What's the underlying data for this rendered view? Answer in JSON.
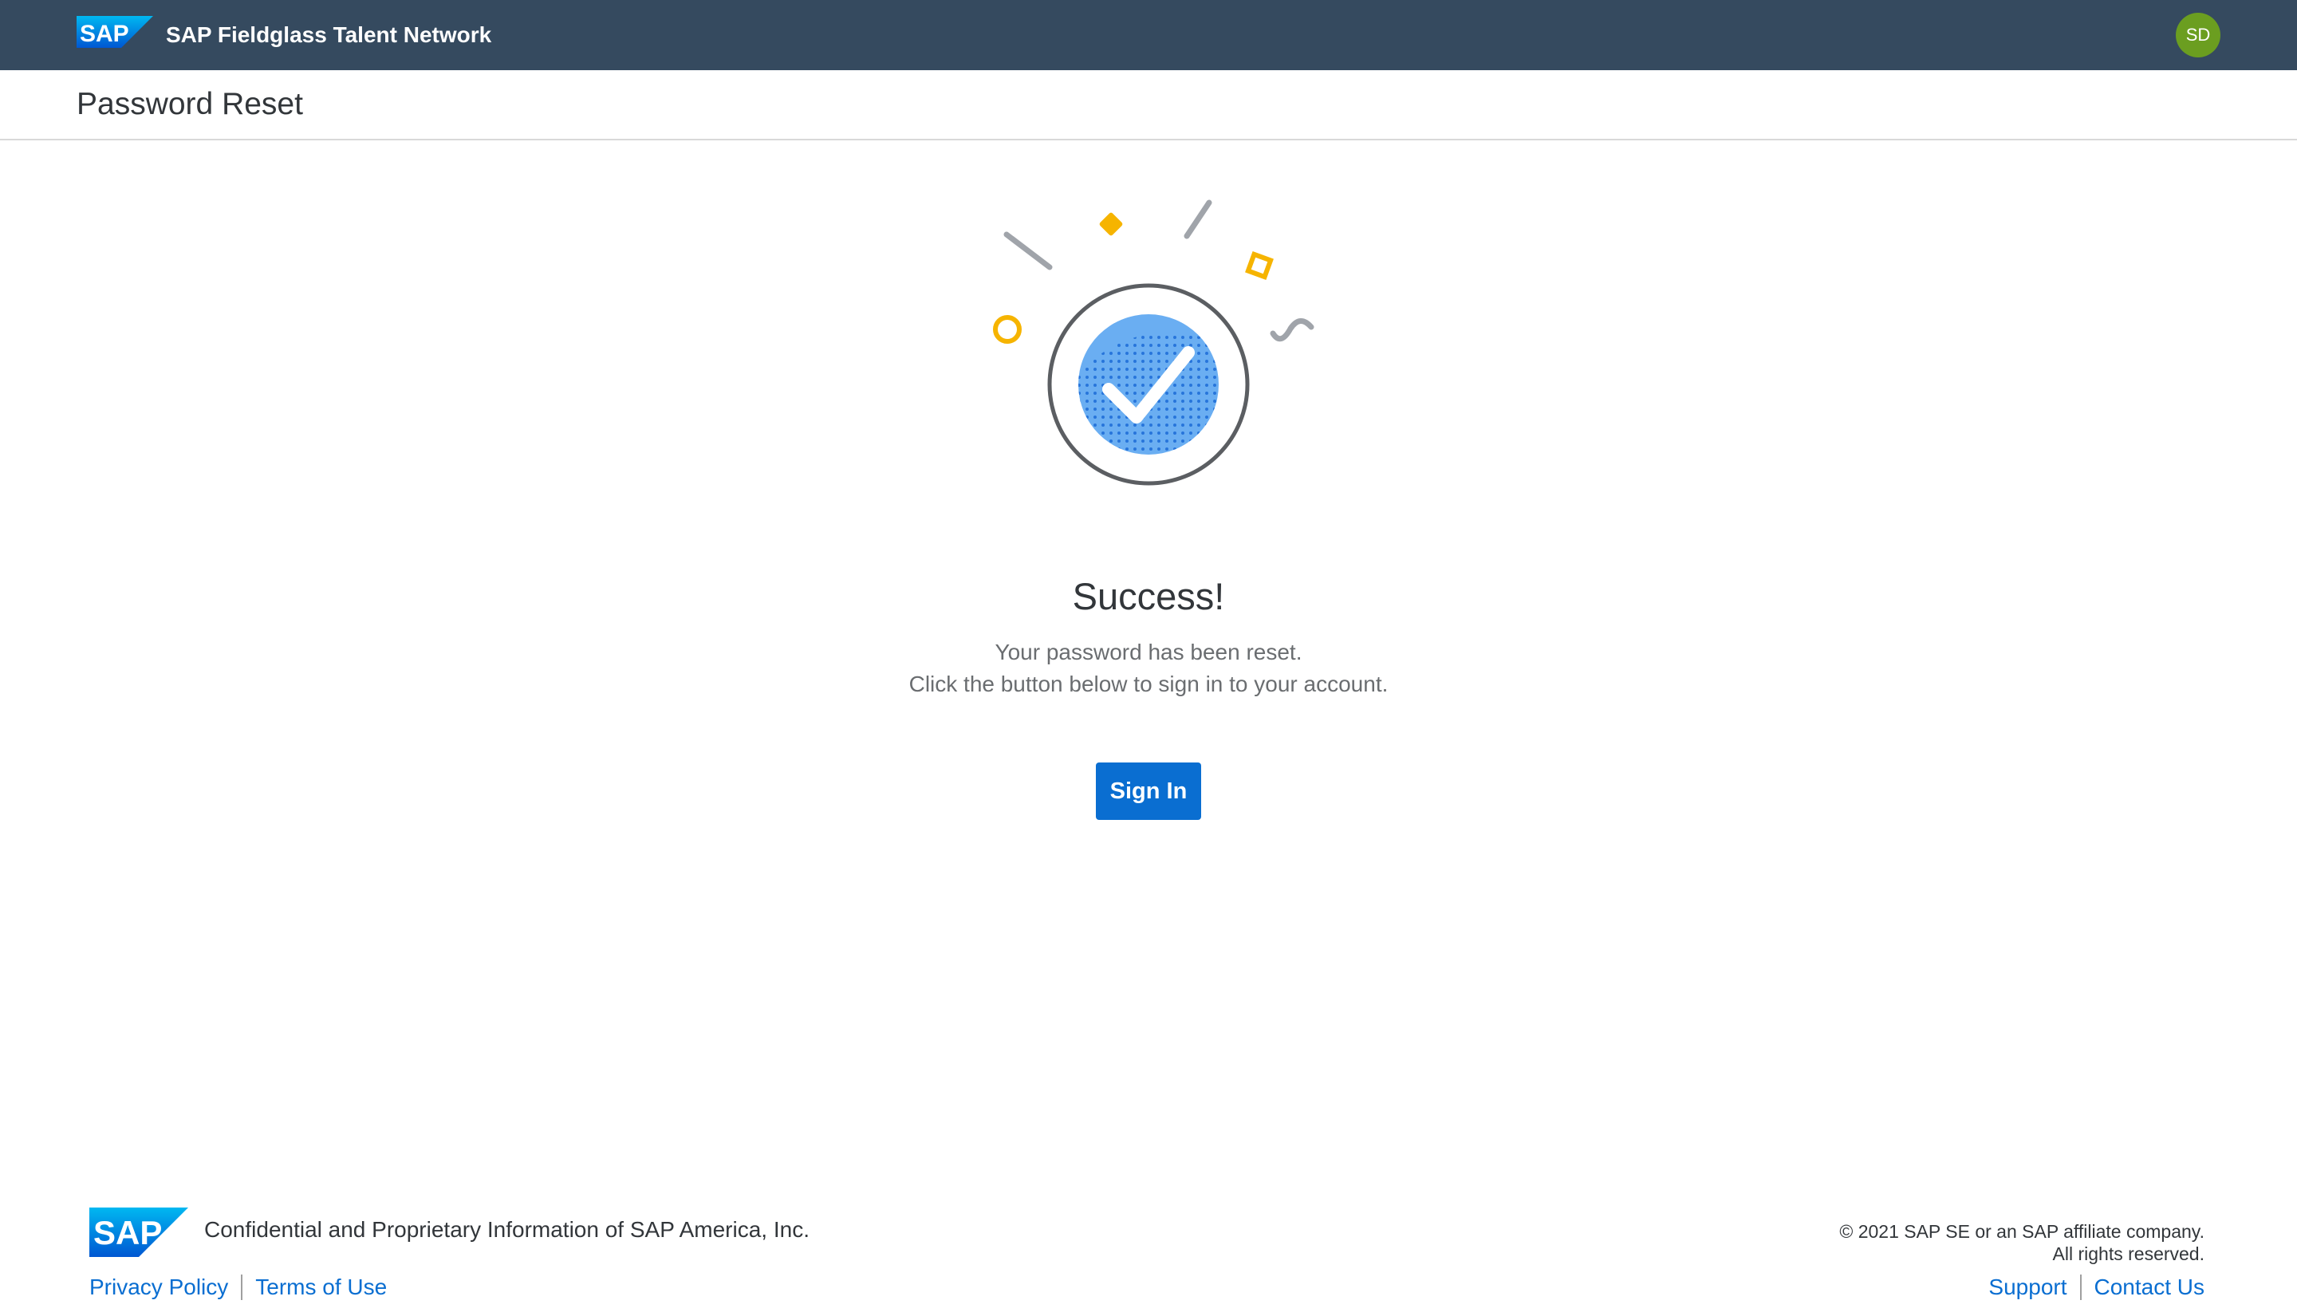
{
  "shell": {
    "logo": "SAP",
    "app_title": "SAP Fieldglass Talent Network",
    "avatar_initials": "SD",
    "bg_color": "#354a5f"
  },
  "page": {
    "title": "Password Reset"
  },
  "illustration": {
    "icon": "success-checkmark-illustration"
  },
  "message": {
    "title": "Success!",
    "line1": "Your password has been reset.",
    "line2": "Click the button below to sign in to your account."
  },
  "actions": {
    "sign_in_label": "Sign In",
    "accent_color": "#0a6ed1"
  },
  "footer": {
    "logo": "SAP",
    "confidential": "Confidential and Proprietary Information of SAP America, Inc.",
    "copyright_line1": "© 2021 SAP SE or an SAP affiliate company.",
    "copyright_line2": "All rights reserved.",
    "links_left": [
      "Privacy Policy",
      "Terms of Use"
    ],
    "links_right": [
      "Support",
      "Contact Us"
    ]
  }
}
